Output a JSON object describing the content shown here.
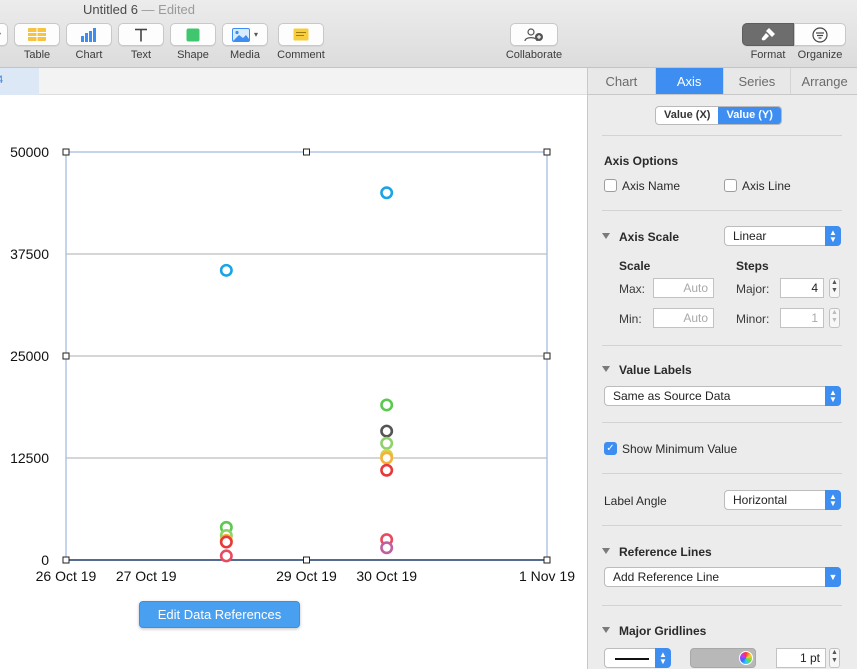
{
  "window": {
    "title": "Untitled 6",
    "status": "— Edited"
  },
  "toolbar": {
    "items": [
      {
        "label": "Table",
        "icon": "table-icon"
      },
      {
        "label": "Chart",
        "icon": "chart-icon"
      },
      {
        "label": "Text",
        "icon": "text-icon"
      },
      {
        "label": "Shape",
        "icon": "shape-icon"
      },
      {
        "label": "Media",
        "icon": "media-icon"
      },
      {
        "label": "Comment",
        "icon": "comment-icon"
      },
      {
        "label": "Collaborate",
        "icon": "collaborate-icon"
      },
      {
        "label": "Format",
        "icon": "format-brush-icon"
      },
      {
        "label": "Organize",
        "icon": "organize-icon"
      }
    ]
  },
  "canvas": {
    "ruler_text": "4",
    "edit_button": "Edit Data References"
  },
  "chart_data": {
    "type": "scatter",
    "x_axis": {
      "type": "date",
      "tick_labels": [
        "26 Oct 19",
        "27 Oct 19",
        "29 Oct 19",
        "30 Oct 19",
        "1 Nov 19"
      ]
    },
    "y_axis": {
      "min": 0,
      "max": 50000,
      "tick_labels": [
        "0",
        "12500",
        "25000",
        "37500",
        "50000"
      ],
      "major_steps": 4,
      "gridlines": true
    },
    "marker": "hollow-circle",
    "series": [
      {
        "color": "#1aa3e6",
        "points": [
          {
            "x": "28 Oct 19",
            "y": 35500
          },
          {
            "x": "30 Oct 19",
            "y": 45000
          }
        ]
      },
      {
        "color": "#5bc950",
        "points": [
          {
            "x": "28 Oct 19",
            "y": 4000
          },
          {
            "x": "30 Oct 19",
            "y": 19000
          }
        ]
      },
      {
        "color": "#555555",
        "points": [
          {
            "x": "30 Oct 19",
            "y": 15800
          }
        ]
      },
      {
        "color": "#8ed26a",
        "points": [
          {
            "x": "28 Oct 19",
            "y": 3000
          },
          {
            "x": "30 Oct 19",
            "y": 14300
          }
        ]
      },
      {
        "color": "#d7d34a",
        "points": [
          {
            "x": "30 Oct 19",
            "y": 12800
          }
        ]
      },
      {
        "color": "#f3b33b",
        "points": [
          {
            "x": "28 Oct 19",
            "y": 2400
          },
          {
            "x": "30 Oct 19",
            "y": 12500
          }
        ]
      },
      {
        "color": "#e8393a",
        "points": [
          {
            "x": "28 Oct 19",
            "y": 2200
          },
          {
            "x": "30 Oct 19",
            "y": 11000
          }
        ]
      },
      {
        "color": "#e84a5f",
        "points": [
          {
            "x": "28 Oct 19",
            "y": 500
          },
          {
            "x": "30 Oct 19",
            "y": 2500
          }
        ]
      },
      {
        "color": "#c060a0",
        "points": [
          {
            "x": "30 Oct 19",
            "y": 1500
          }
        ]
      }
    ]
  },
  "panel": {
    "tabs": [
      "Chart",
      "Axis",
      "Series",
      "Arrange"
    ],
    "active_tab": "Axis",
    "axis_toggle": [
      "Value (X)",
      "Value (Y)"
    ],
    "axis_options_title": "Axis Options",
    "axis_name_label": "Axis Name",
    "axis_line_label": "Axis Line",
    "axis_scale_label": "Axis Scale",
    "axis_scale_value": "Linear",
    "scale_header": "Scale",
    "steps_header": "Steps",
    "max_label": "Max:",
    "max_placeholder": "Auto",
    "min_label": "Min:",
    "min_placeholder": "Auto",
    "major_label": "Major:",
    "major_value": "4",
    "minor_label": "Minor:",
    "minor_value": "1",
    "value_labels_title": "Value Labels",
    "value_labels_value": "Same as Source Data",
    "show_min_label": "Show Minimum Value",
    "show_min_checked": "✓",
    "label_angle_label": "Label Angle",
    "label_angle_value": "Horizontal",
    "reference_lines_title": "Reference Lines",
    "reference_lines_value": "Add Reference Line",
    "major_gridlines_title": "Major Gridlines",
    "gridline_width": "1 pt"
  },
  "colors": {
    "accent": "#3d8ef0",
    "selection_blue": "#3b82e0"
  }
}
